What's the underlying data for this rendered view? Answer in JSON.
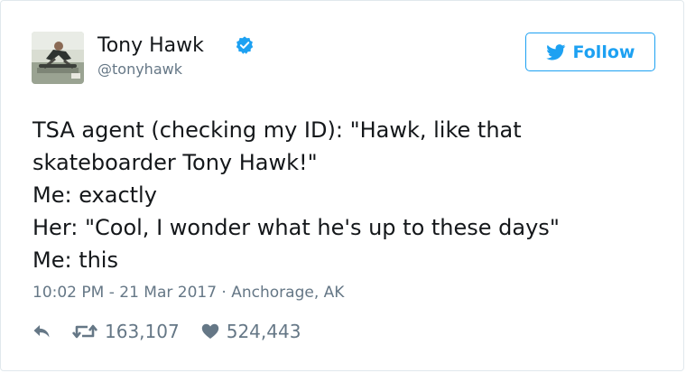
{
  "user": {
    "name": "Tony Hawk",
    "handle": "@tonyhawk"
  },
  "follow_button": {
    "label": "Follow"
  },
  "tweet": {
    "lines": [
      "TSA agent (checking my ID): \"Hawk, like that",
      "skateboarder Tony Hawk!\"",
      "Me: exactly",
      "Her: \"Cool, I wonder what he's up to these days\"",
      "Me: this"
    ],
    "meta": "10:02 PM - 21 Mar 2017 · Anchorage, AK"
  },
  "stats": {
    "retweets": "163,107",
    "likes": "524,443"
  },
  "colors": {
    "accent": "#1da1f2",
    "muted": "#657786",
    "text": "#14171a",
    "border": "#e1e8ed"
  },
  "icons": {
    "verified": "verified-badge-icon",
    "follow": "twitter-bird-icon",
    "reply": "reply-arrow-icon",
    "retweet": "retweet-icon",
    "like": "heart-icon"
  }
}
